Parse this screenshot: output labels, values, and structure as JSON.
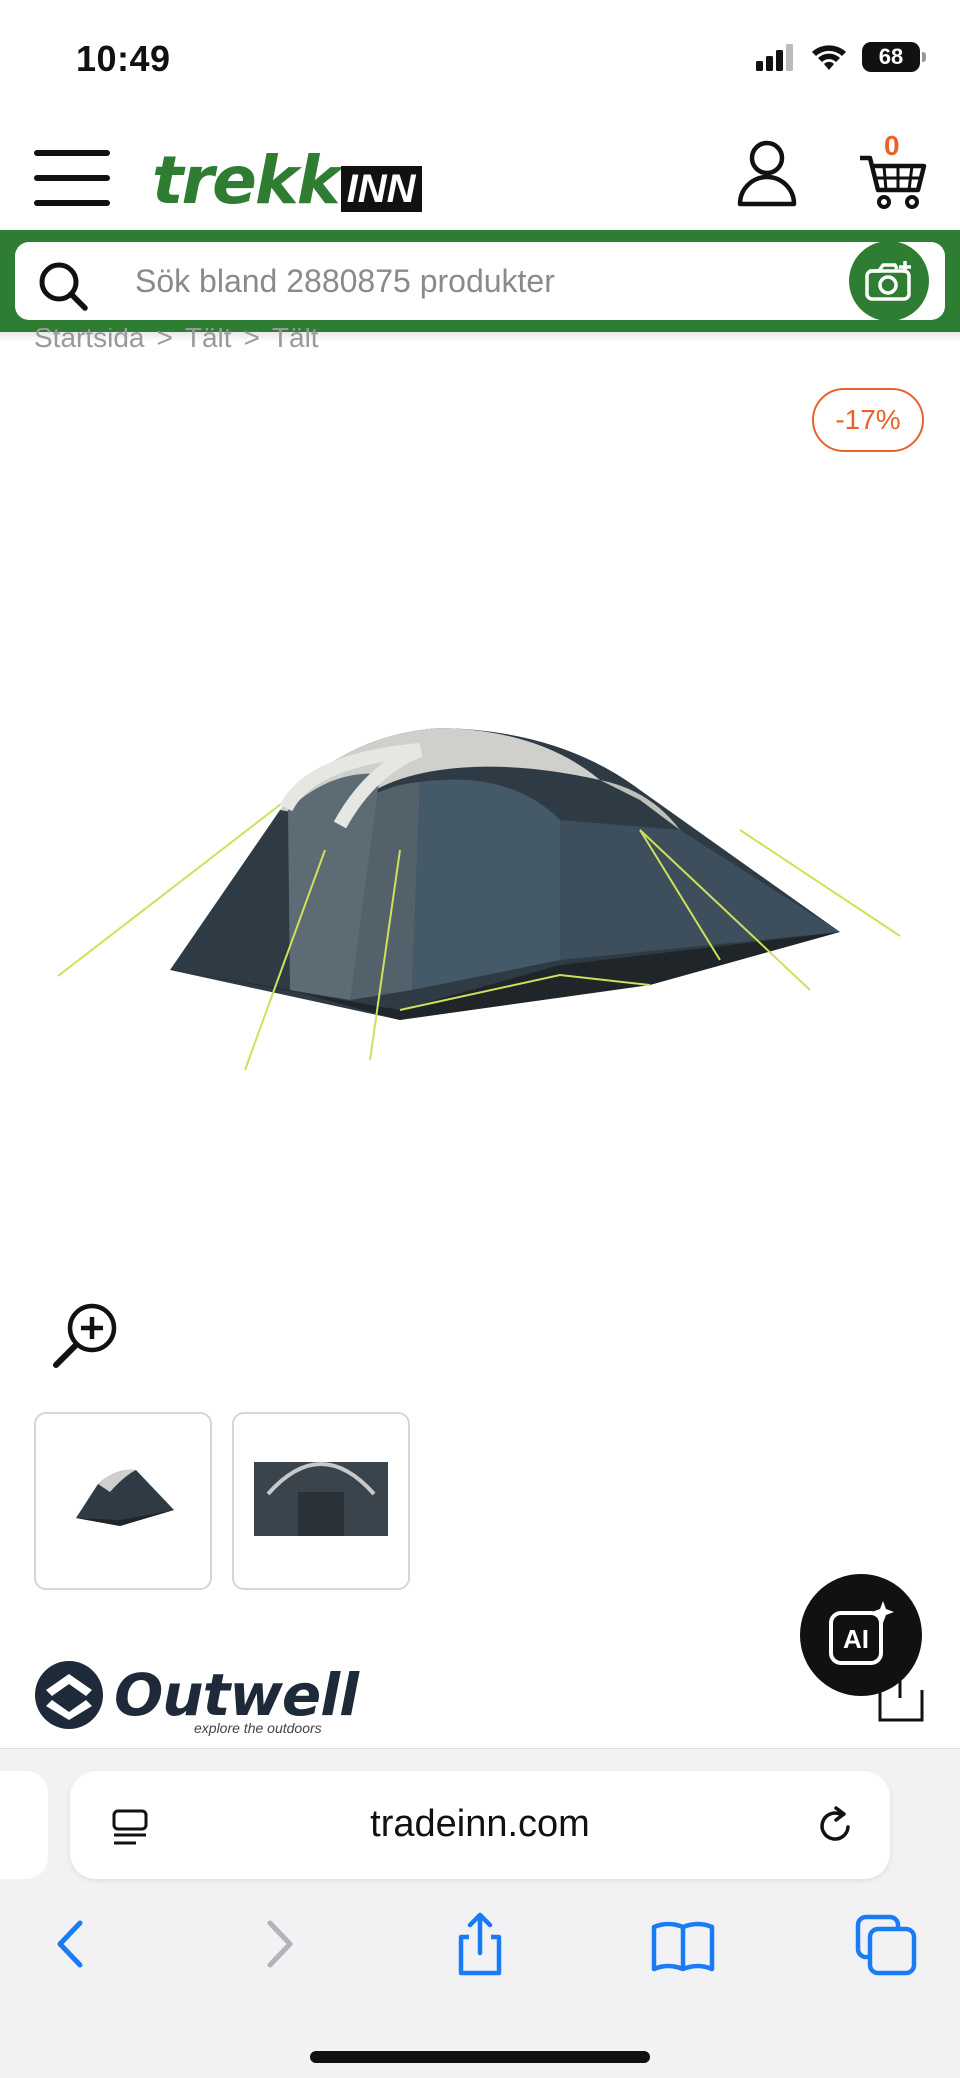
{
  "status_bar": {
    "time": "10:49",
    "battery": "68"
  },
  "header": {
    "logo_main": "trekk",
    "logo_accent": "INN",
    "cart_count": "0"
  },
  "search": {
    "placeholder": "Sök bland 2880875 produkter"
  },
  "breadcrumb": [
    "Startsida",
    ">",
    "Tält",
    ">",
    "Tält"
  ],
  "product": {
    "discount": "-17%",
    "brand": "Outwell",
    "brand_tagline": "explore the outdoors"
  },
  "browser": {
    "url": "tradeinn.com"
  },
  "ai_button": {
    "label": "AI"
  },
  "colors": {
    "brand_green": "#2e7d32",
    "accent_orange": "#e8622a",
    "ios_blue": "#1a7cf5"
  },
  "icons": [
    "menu-icon",
    "user-icon",
    "cart-icon",
    "search-icon",
    "camera-icon",
    "zoom-in-icon",
    "ai-icon",
    "reader-icon",
    "reload-icon",
    "back-icon",
    "forward-icon",
    "share-icon",
    "bookmarks-icon",
    "tabs-icon"
  ]
}
